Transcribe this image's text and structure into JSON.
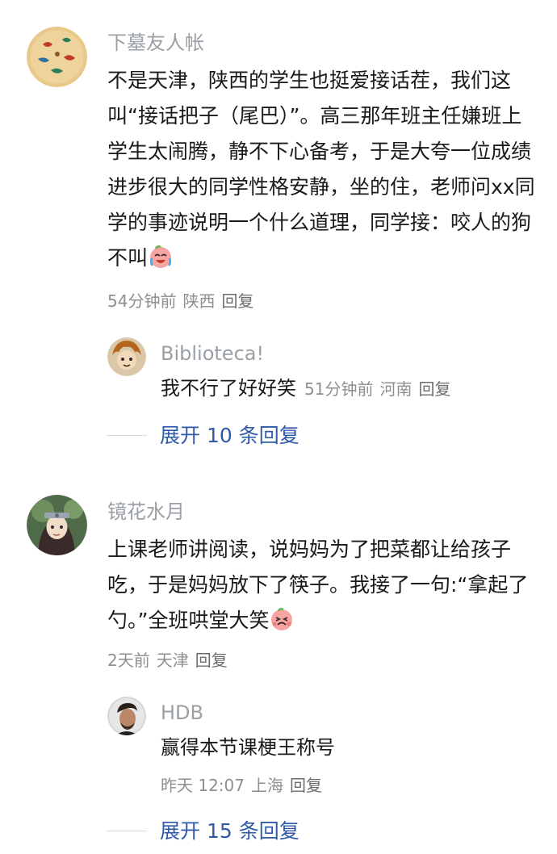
{
  "comments": [
    {
      "username": "下墓友人帐",
      "text": "不是天津，陕西的学生也挺爱接话茬，我们这叫“接话把子（尾巴）”。高三那年班主任嫌班上学生太闹腾，静不下心备考，于是大夸一位成绩进步很大的同学性格安静，坐的住，老师问xx同学的事迹说明一个什么道理，同学接：咬人的狗不叫",
      "time": "54分钟前",
      "location": "陕西",
      "reply_label": "回复",
      "sub_reply": {
        "username": "Biblioteca!",
        "text": "我不行了好好笑",
        "time": "51分钟前",
        "location": "河南",
        "reply_label": "回复"
      },
      "expand_label": "展开 10 条回复"
    },
    {
      "username": "镜花水月",
      "text": "上课老师讲阅读，说妈妈为了把菜都让给孩子吃，于是妈妈放下了筷子。我接了一句:“拿起了勺。”全班哄堂大笑",
      "time": "2天前",
      "location": "天津",
      "reply_label": "回复",
      "sub_reply": {
        "username": "HDB",
        "text": "赢得本节课梗王称号",
        "time": "昨天 12:07",
        "location": "上海",
        "reply_label": "回复"
      },
      "expand_label": "展开 15 条回复"
    }
  ],
  "colors": {
    "link": "#2e5aa7",
    "meta": "#8e8e93",
    "username": "#9aa0a6"
  },
  "icons": [
    "laughing-crying-emoji",
    "holding-laugh-emoji"
  ]
}
